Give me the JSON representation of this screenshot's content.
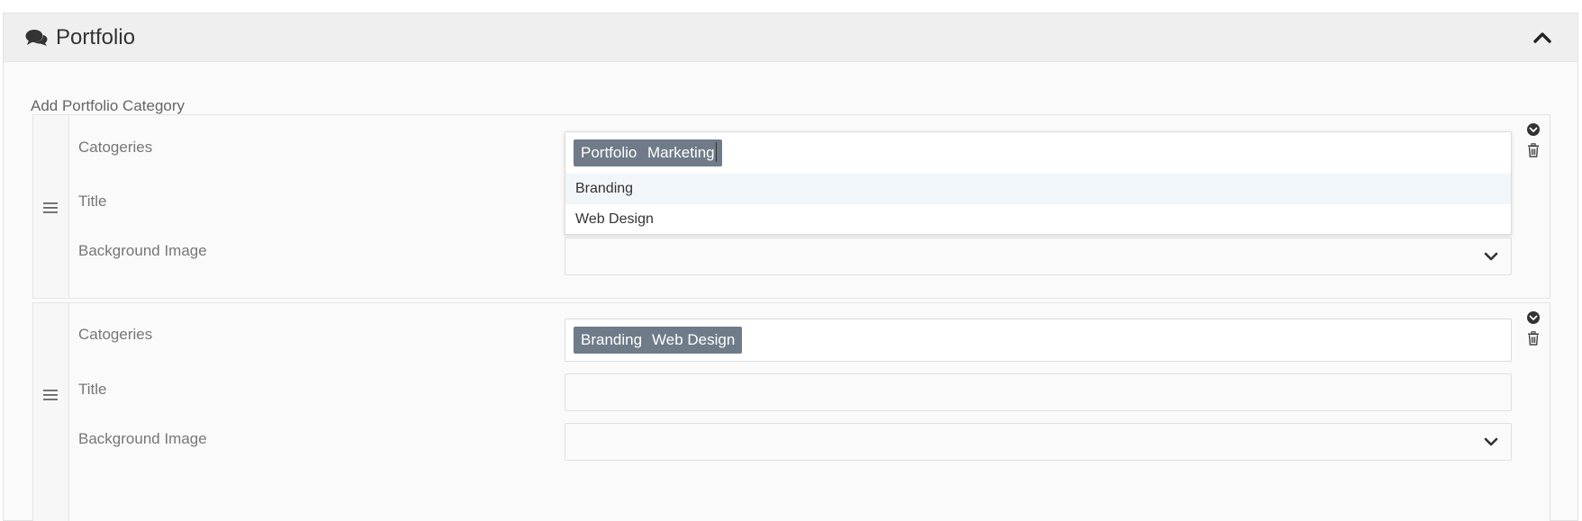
{
  "panel": {
    "title": "Portfolio",
    "header_icon": "comments-icon",
    "collapse_icon": "chevron-up-icon"
  },
  "section_label": "Add Portfolio Category",
  "rows": [
    {
      "labels": {
        "categories": "Catogeries",
        "title": "Title",
        "background": "Background Image"
      },
      "tags": [
        "Portfolio",
        "Marketing"
      ],
      "dropdown_options": [
        "Branding",
        "Web Design"
      ],
      "title_value": "",
      "background_value": ""
    },
    {
      "labels": {
        "categories": "Catogeries",
        "title": "Title",
        "background": "Background Image"
      },
      "tags": [
        "Branding",
        "Web Design"
      ],
      "title_value": "",
      "background_value": ""
    }
  ],
  "icons": {
    "drag": "drag-handle-icon",
    "toggle": "circle-chevron-down-icon",
    "delete": "trash-icon",
    "select": "chevron-down-icon"
  },
  "colors": {
    "tag_bg": "#6f7b88",
    "header_bg": "#efefef",
    "highlight": "#f1f6fa"
  }
}
